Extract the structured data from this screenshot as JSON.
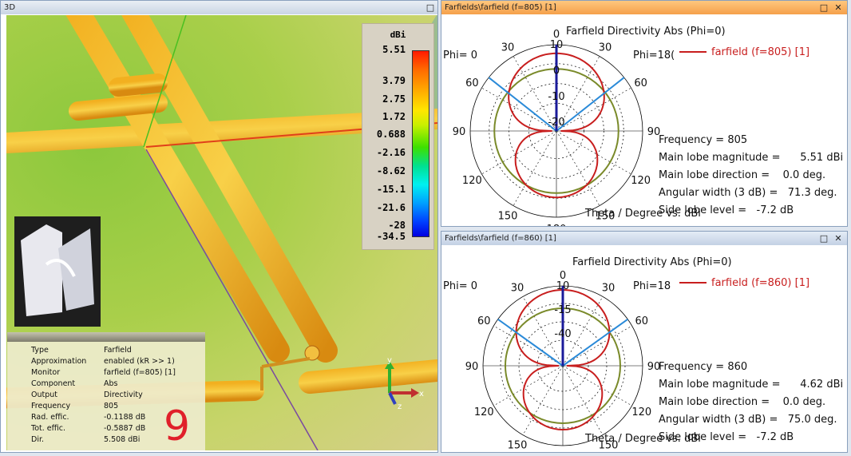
{
  "view3d": {
    "title": "3D",
    "colorbar": {
      "unit": "dBi",
      "ticks": [
        "5.51",
        "3.79",
        "2.75",
        "1.72",
        "0.688",
        "-2.16",
        "-8.62",
        "-15.1",
        "-21.6",
        "-28",
        "-34.5"
      ]
    },
    "info": [
      {
        "k": "Type",
        "v": "Farfield"
      },
      {
        "k": "Approximation",
        "v": "enabled (kR >> 1)"
      },
      {
        "k": "Monitor",
        "v": "farfield (f=805) [1]"
      },
      {
        "k": "Component",
        "v": "Abs"
      },
      {
        "k": "Output",
        "v": "Directivity"
      },
      {
        "k": "Frequency",
        "v": "805"
      },
      {
        "k": "Rad. effic.",
        "v": "-0.1188 dB"
      },
      {
        "k": "Tot. effic.",
        "v": "-0.5887 dB"
      },
      {
        "k": "Dir.",
        "v": "5.508 dBi"
      }
    ],
    "overlay_number": "9",
    "axes": {
      "x": "x",
      "y": "y",
      "z": "z"
    }
  },
  "plots": [
    {
      "window_title": "Farfields\\farfield (f=805) [1]",
      "title": "Farfield Directivity Abs (Phi=0)",
      "phi_left": "Phi=  0",
      "phi_right": "Phi=18(",
      "legend": "farfield (f=805) [1]",
      "xlabel": "Theta / Degree vs. dBi",
      "stats": [
        "Frequency = 805",
        "Main lobe magnitude =      5.51 dBi",
        "Main lobe direction =    0.0 deg.",
        "Angular width (3 dB) =   71.3 deg.",
        "Side lobe level =   -7.2 dB"
      ],
      "radial_ticks": [
        "10",
        "0",
        "-10",
        "-20"
      ],
      "main_lobe_deg": 0,
      "beamwidth_deg": 71.3,
      "front_scale": 0.85,
      "back_scale": 0.72
    },
    {
      "window_title": "Farfields\\farfield (f=860) [1]",
      "title": "Farfield Directivity Abs (Phi=0)",
      "phi_left": "Phi=  0",
      "phi_right": "Phi=18",
      "legend": "farfield (f=860) [1]",
      "xlabel": "Theta / Degree vs. dBi",
      "stats": [
        "Frequency = 860",
        "Main lobe magnitude =      4.62 dBi",
        "Main lobe direction =    0.0 deg.",
        "Angular width (3 dB) =   75.0 deg.",
        "Side lobe level =   -7.2 dB"
      ],
      "radial_ticks": [
        "10",
        "-15",
        "-40"
      ],
      "main_lobe_deg": 0,
      "beamwidth_deg": 75.0,
      "front_scale": 0.9,
      "back_scale": 0.75
    }
  ],
  "colors": {
    "curve": "#c81e1e",
    "beam": "#2a8ad8",
    "circle3db": "#7a8a2a",
    "mainlobe": "#1a1a9a",
    "active_title": "#f5a04a"
  }
}
